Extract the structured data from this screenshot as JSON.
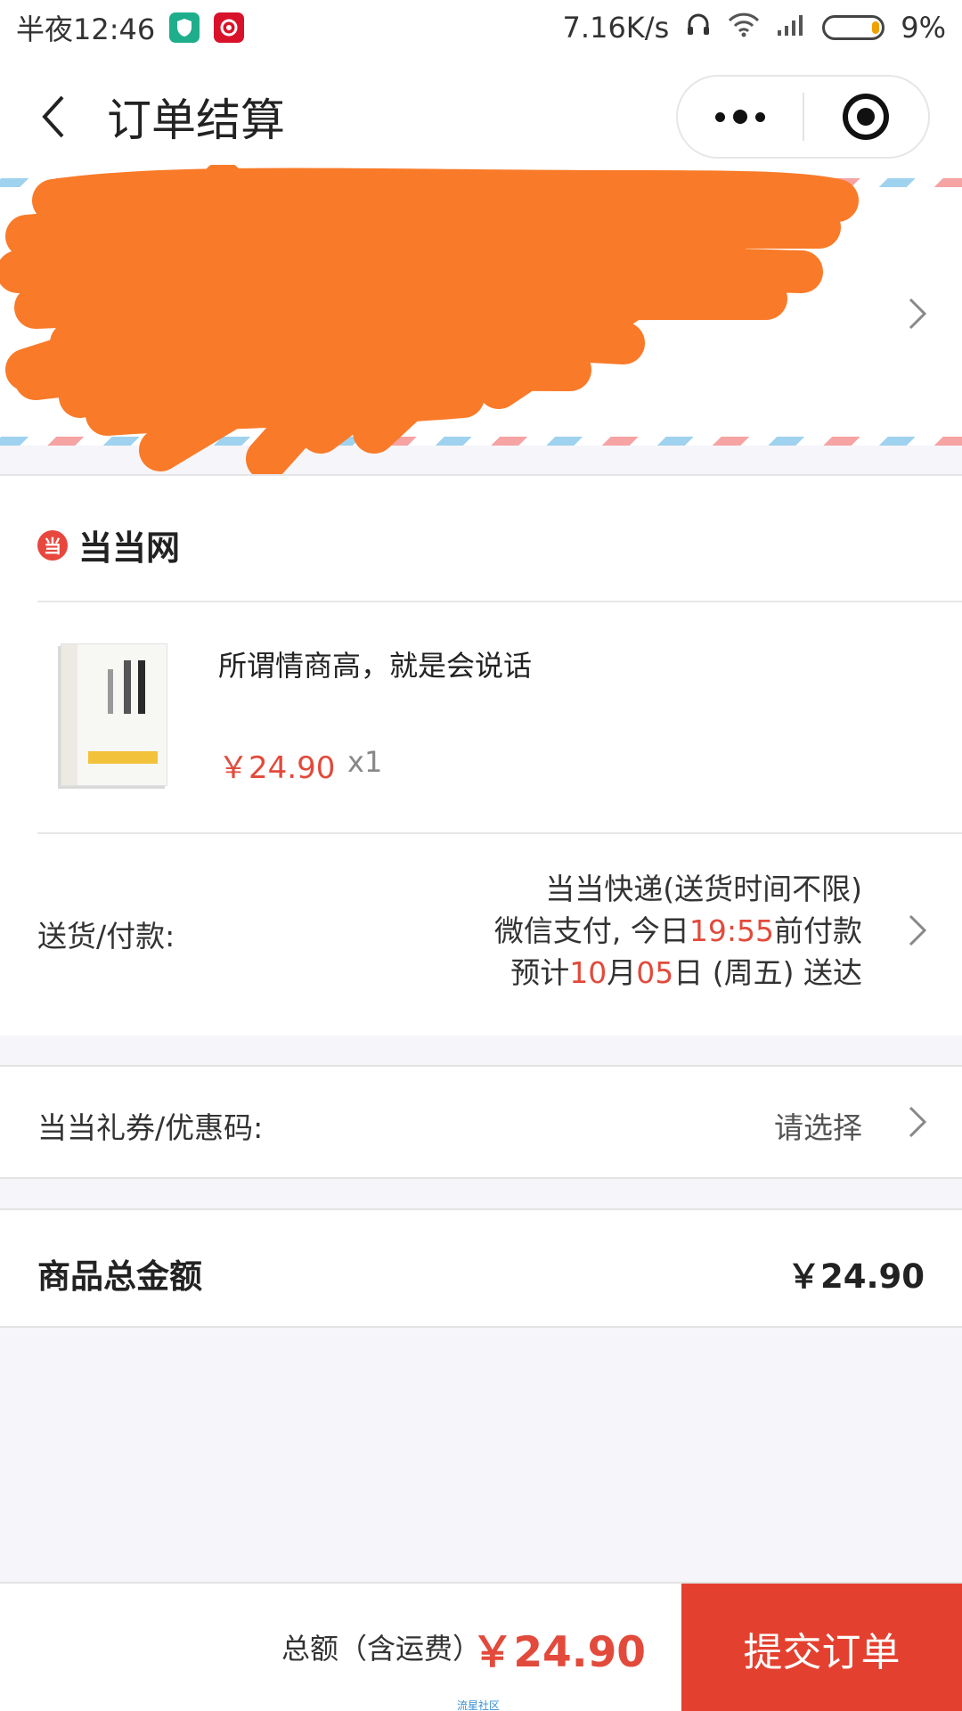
{
  "status_bar": {
    "time": "半夜12:46",
    "app_icons": [
      "shield-app-icon",
      "netease-music-icon"
    ],
    "network_speed": "7.16K/s",
    "battery_percent": "9%",
    "battery_level": 0.09
  },
  "nav": {
    "title": "订单结算",
    "icons": [
      "back-icon",
      "more-icon",
      "close-miniprogram-icon"
    ]
  },
  "address": {
    "redacted": true
  },
  "store": {
    "name": "当当网",
    "logo_glyph": "当"
  },
  "product": {
    "title": "所谓情商高，就是会说话",
    "price": "￥24.90",
    "quantity": "x1"
  },
  "delivery": {
    "label": "送货/付款:",
    "line1": "当当快递(送货时间不限)",
    "line2_prefix": "微信支付, 今日",
    "line2_time": "19:55",
    "line2_suffix": "前付款",
    "line3_prefix": "预计",
    "line3_month": "10",
    "line3_mid": "月",
    "line3_day": "05",
    "line3_suffix": "日 (周五) 送达"
  },
  "coupon": {
    "label": "当当礼券/优惠码:",
    "value": "请选择"
  },
  "summary": {
    "label": "商品总金额",
    "value": "￥24.90"
  },
  "bottom": {
    "total_label": "总额（含运费）",
    "total_value": "￥24.90",
    "submit_label": "提交订单"
  },
  "watermark": "流星社区",
  "colors": {
    "accent_red": "#e4402f",
    "price_red": "#e24a3b",
    "scribble_orange": "#f97a28"
  }
}
